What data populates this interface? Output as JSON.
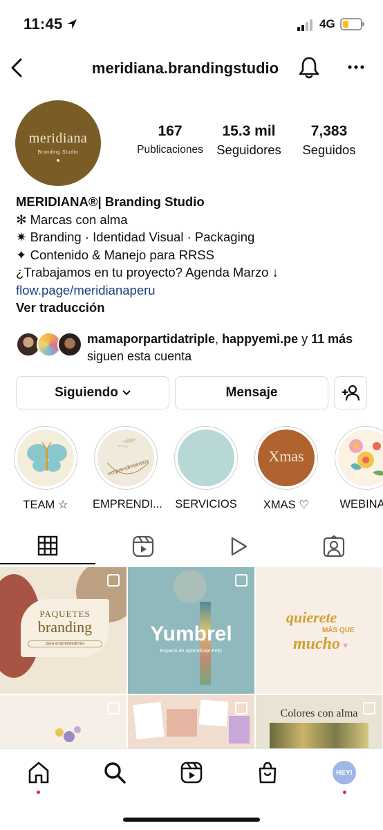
{
  "status_bar": {
    "time": "11:45",
    "network": "4G",
    "battery_level": 0.35
  },
  "header": {
    "username": "meridiana.brandingstudio"
  },
  "avatar": {
    "brand": "meridiana",
    "subtitle": "Branding Studio"
  },
  "stats": [
    {
      "value": "167",
      "label": "Publicaciones"
    },
    {
      "value": "15.3 mil",
      "label": "Seguidores"
    },
    {
      "value": "7,383",
      "label": "Seguidos"
    }
  ],
  "bio": {
    "name": "MERIDIANA®| Branding Studio",
    "lines": [
      "✻ Marcas con alma",
      "✷ Branding · Identidad Visual · Packaging",
      "✦ Contenido & Manejo para RRSS",
      "¿Trabajamos en tu proyecto? Agenda Marzo ↓"
    ],
    "link": "flow.page/meridianaperu",
    "translate": "Ver traducción"
  },
  "followed_by": {
    "user1": "mamaporpartidatriple",
    "sep1": ", ",
    "user2": "happyemi.pe",
    "sep2": " y ",
    "more": "11 más",
    "suffix": " siguen esta cuenta"
  },
  "buttons": {
    "following": "Siguiendo",
    "message": "Mensaje"
  },
  "highlights": [
    {
      "label": "TEAM ☆"
    },
    {
      "label": "EMPRENDI...",
      "inner_text": "emprendimientos"
    },
    {
      "label": "SERVICIOS"
    },
    {
      "label": "XMAS ♡",
      "inner_text": "Xmas"
    },
    {
      "label": "WEBINAR"
    }
  ],
  "posts": [
    {
      "line1": "PAQUETES",
      "line2": "branding",
      "line3": "para emprendedores"
    },
    {
      "line1": "Yumbrel",
      "line2": "Espacio de aprendizaje Feliz"
    },
    {
      "line1": "quierete",
      "line2": "MÁS QUE",
      "line3": "mucho"
    },
    {
      "line1": ""
    },
    {
      "line1": ""
    },
    {
      "line1": "Colores con alma"
    }
  ],
  "bottom_nav": {
    "profile_badge": "HEY!"
  },
  "colors": {
    "brand_brown": "#7a5c26",
    "link_blue": "#1d3e7a",
    "notif_dot": "#e0245e"
  }
}
